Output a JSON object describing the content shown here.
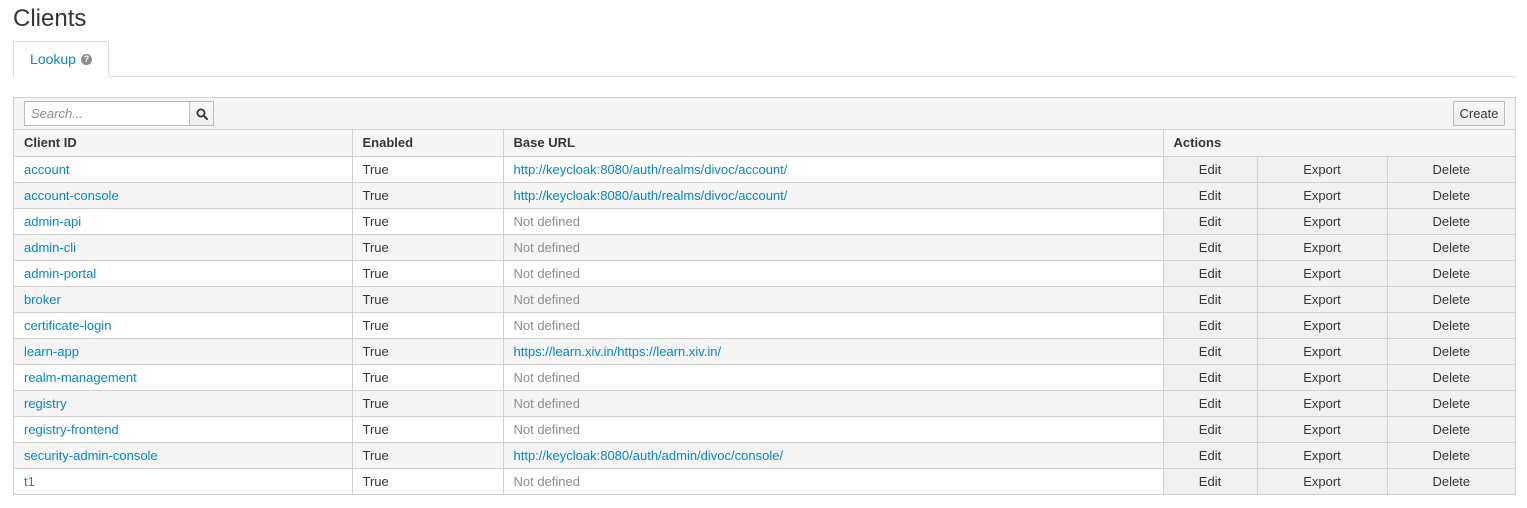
{
  "page": {
    "title": "Clients"
  },
  "tabs": [
    {
      "label": "Lookup"
    }
  ],
  "toolbar": {
    "search_placeholder": "Search...",
    "create_label": "Create"
  },
  "table": {
    "columns": [
      "Client ID",
      "Enabled",
      "Base URL",
      "Actions"
    ],
    "action_labels": {
      "edit": "Edit",
      "export": "Export",
      "delete": "Delete"
    },
    "rows": [
      {
        "client_id": "account",
        "enabled": "True",
        "base_url": "http://keycloak:8080/auth/realms/divoc/account/"
      },
      {
        "client_id": "account-console",
        "enabled": "True",
        "base_url": "http://keycloak:8080/auth/realms/divoc/account/"
      },
      {
        "client_id": "admin-api",
        "enabled": "True",
        "base_url": "Not defined"
      },
      {
        "client_id": "admin-cli",
        "enabled": "True",
        "base_url": "Not defined"
      },
      {
        "client_id": "admin-portal",
        "enabled": "True",
        "base_url": "Not defined"
      },
      {
        "client_id": "broker",
        "enabled": "True",
        "base_url": "Not defined"
      },
      {
        "client_id": "certificate-login",
        "enabled": "True",
        "base_url": "Not defined"
      },
      {
        "client_id": "learn-app",
        "enabled": "True",
        "base_url": "https://learn.xiv.in/https://learn.xiv.in/"
      },
      {
        "client_id": "realm-management",
        "enabled": "True",
        "base_url": "Not defined"
      },
      {
        "client_id": "registry",
        "enabled": "True",
        "base_url": "Not defined"
      },
      {
        "client_id": "registry-frontend",
        "enabled": "True",
        "base_url": "Not defined"
      },
      {
        "client_id": "security-admin-console",
        "enabled": "True",
        "base_url": "http://keycloak:8080/auth/admin/divoc/console/"
      },
      {
        "client_id": "t1",
        "enabled": "True",
        "base_url": "Not defined"
      }
    ]
  },
  "colors": {
    "link": "#0088ce",
    "muted": "#8b8d8f",
    "header_bg": "#f5f5f5",
    "border": "#d1d1d1"
  },
  "icons": {
    "help": "question-circle-icon",
    "search": "magnifier-icon"
  }
}
